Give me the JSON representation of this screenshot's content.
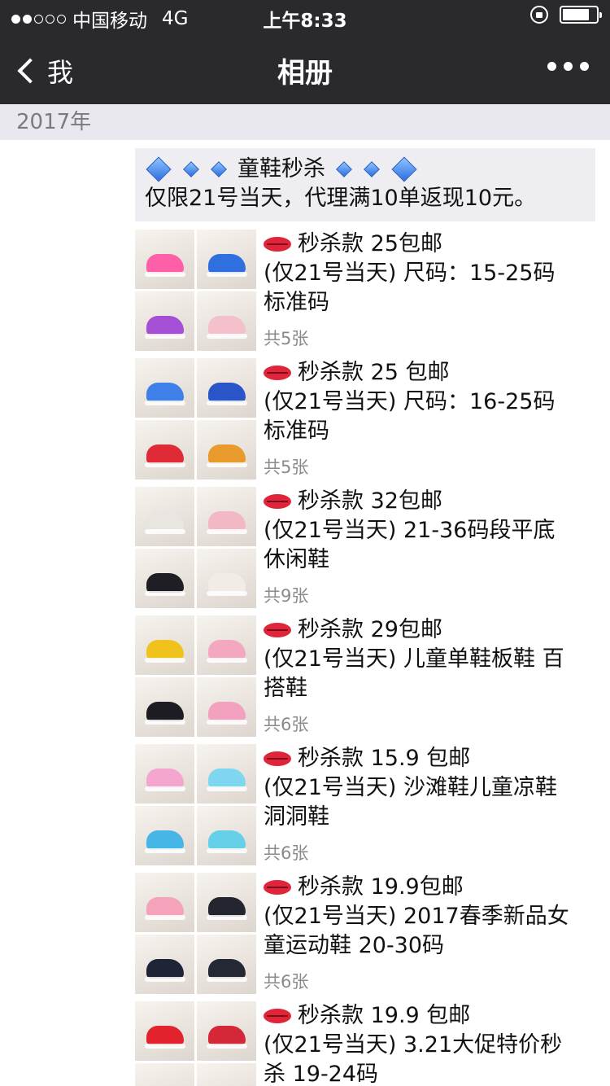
{
  "status_bar": {
    "carrier": "中国移动",
    "network": "4G",
    "time": "上午8:33",
    "signal_bars_filled": 2,
    "signal_bars_total": 5,
    "battery_level": 0.75
  },
  "nav": {
    "back_label": "我",
    "title": "相册"
  },
  "year_label": "2017年",
  "notice": {
    "line1": "童鞋秒杀",
    "line2": "仅限21号当天，代理满10单返现10元。"
  },
  "posts": [
    {
      "price": "秒杀款 25包邮",
      "line2": "(仅21号当天) 尺码：15-25码",
      "line3": "标准码",
      "count": "共5张",
      "colors": [
        "#ff5fa8",
        "#2f6fe0",
        "#a54fd6",
        "#f4c0cc"
      ]
    },
    {
      "price": "秒杀款 25 包邮",
      "line2": "(仅21号当天) 尺码：16-25码",
      "line3": "标准码",
      "count": "共5张",
      "colors": [
        "#3f7fe8",
        "#2a55c8",
        "#e02b36",
        "#e89a2c"
      ]
    },
    {
      "price": "秒杀款 32包邮",
      "line2": "(仅21号当天) 21-36码段平底",
      "line3": "休闲鞋",
      "count": "共9张",
      "colors": [
        "#e9e6e2",
        "#f3b8c6",
        "#1e1e24",
        "#f2ece6"
      ]
    },
    {
      "price": "秒杀款 29包邮",
      "line2": "(仅21号当天) 儿童单鞋板鞋 百",
      "line3": "搭鞋",
      "count": "共6张",
      "colors": [
        "#f2c21c",
        "#f4a8c0",
        "#1c1c22",
        "#f2a2be"
      ]
    },
    {
      "price": "秒杀款 15.9 包邮",
      "line2": "(仅21号当天) 沙滩鞋儿童凉鞋",
      "line3": "洞洞鞋",
      "count": "共6张",
      "colors": [
        "#f4a6cf",
        "#7fd7ef",
        "#46b6e6",
        "#66d0e8"
      ]
    },
    {
      "price": "秒杀款 19.9包邮",
      "line2": "(仅21号当天) 2017春季新品女",
      "line3": "童运动鞋 20-30码",
      "count": "共6张",
      "colors": [
        "#f5a3bb",
        "#23262e",
        "#1f2436",
        "#232834"
      ]
    },
    {
      "price": "秒杀款 19.9 包邮",
      "line2": "(仅21号当天) 3.21大促特价秒",
      "line3": "杀 19-24码",
      "count": "",
      "colors": [
        "#e2232e",
        "#d42838",
        "#7a2a4a",
        "#c83040"
      ]
    }
  ]
}
